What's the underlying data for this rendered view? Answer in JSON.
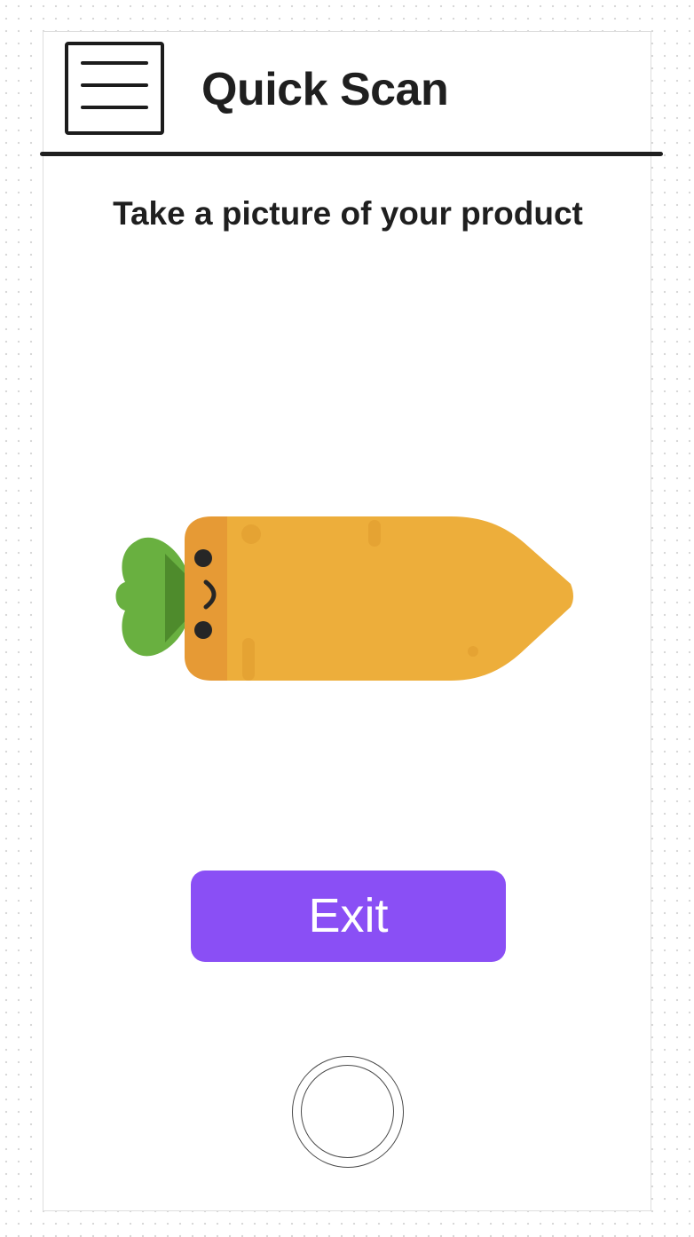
{
  "header": {
    "title": "Quick Scan",
    "menu_icon": "hamburger-menu-icon"
  },
  "main": {
    "instruction": "Take a picture of your product",
    "illustration": "carrot-illustration"
  },
  "actions": {
    "exit_label": "Exit",
    "shutter_icon": "camera-shutter-icon"
  },
  "colors": {
    "accent": "#8a4ff5",
    "carrot_body": "#edae3b",
    "carrot_top": "#e69a35",
    "leaf": "#69b040",
    "leaf_shade": "#4e8b2c",
    "text": "#1f1f1f"
  }
}
